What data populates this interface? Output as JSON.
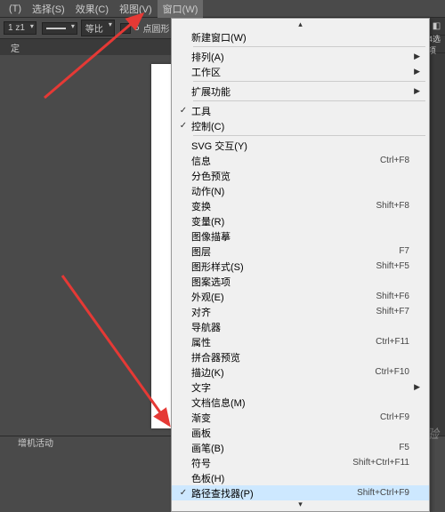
{
  "menubar": {
    "items": [
      {
        "label": "(T)"
      },
      {
        "label": "选择(S)"
      },
      {
        "label": "效果(C)"
      },
      {
        "label": "视图(V)"
      },
      {
        "label": "窗口(W)"
      }
    ]
  },
  "toolbar": {
    "zoom": "1 z1",
    "stroke_label": "等比",
    "shape_count": "5",
    "shape_label": "点圆形"
  },
  "tab": {
    "label": "定"
  },
  "right": {
    "label": "4选项"
  },
  "statusbar": {
    "label": "增机活动"
  },
  "watermark": "Baidu经验",
  "menu": {
    "scroll_up": "▴",
    "groups": [
      {
        "items": [
          {
            "label": "新建窗口(W)",
            "shortcut": "",
            "check": false,
            "submenu": false
          }
        ]
      },
      {
        "items": [
          {
            "label": "排列(A)",
            "shortcut": "",
            "check": false,
            "submenu": true
          },
          {
            "label": "工作区",
            "shortcut": "",
            "check": false,
            "submenu": true
          }
        ]
      },
      {
        "items": [
          {
            "label": "扩展功能",
            "shortcut": "",
            "check": false,
            "submenu": true
          }
        ]
      },
      {
        "items": [
          {
            "label": "工具",
            "shortcut": "",
            "check": true,
            "submenu": false
          },
          {
            "label": "控制(C)",
            "shortcut": "",
            "check": true,
            "submenu": false
          }
        ]
      },
      {
        "items": [
          {
            "label": "SVG 交互(Y)",
            "shortcut": "",
            "check": false,
            "submenu": false
          },
          {
            "label": "信息",
            "shortcut": "Ctrl+F8",
            "check": false,
            "submenu": false
          },
          {
            "label": "分色预览",
            "shortcut": "",
            "check": false,
            "submenu": false
          },
          {
            "label": "动作(N)",
            "shortcut": "",
            "check": false,
            "submenu": false
          },
          {
            "label": "变换",
            "shortcut": "Shift+F8",
            "check": false,
            "submenu": false
          },
          {
            "label": "变量(R)",
            "shortcut": "",
            "check": false,
            "submenu": false
          },
          {
            "label": "图像描摹",
            "shortcut": "",
            "check": false,
            "submenu": false
          },
          {
            "label": "图层",
            "shortcut": "F7",
            "check": false,
            "submenu": false
          },
          {
            "label": "图形样式(S)",
            "shortcut": "Shift+F5",
            "check": false,
            "submenu": false
          },
          {
            "label": "图案选项",
            "shortcut": "",
            "check": false,
            "submenu": false
          },
          {
            "label": "外观(E)",
            "shortcut": "Shift+F6",
            "check": false,
            "submenu": false
          },
          {
            "label": "对齐",
            "shortcut": "Shift+F7",
            "check": false,
            "submenu": false
          },
          {
            "label": "导航器",
            "shortcut": "",
            "check": false,
            "submenu": false
          },
          {
            "label": "属性",
            "shortcut": "Ctrl+F11",
            "check": false,
            "submenu": false
          },
          {
            "label": "拼合器预览",
            "shortcut": "",
            "check": false,
            "submenu": false
          },
          {
            "label": "描边(K)",
            "shortcut": "Ctrl+F10",
            "check": false,
            "submenu": false
          },
          {
            "label": "文字",
            "shortcut": "",
            "check": false,
            "submenu": true
          },
          {
            "label": "文档信息(M)",
            "shortcut": "",
            "check": false,
            "submenu": false
          },
          {
            "label": "渐变",
            "shortcut": "Ctrl+F9",
            "check": false,
            "submenu": false
          },
          {
            "label": "画板",
            "shortcut": "",
            "check": false,
            "submenu": false
          },
          {
            "label": "画笔(B)",
            "shortcut": "F5",
            "check": false,
            "submenu": false
          },
          {
            "label": "符号",
            "shortcut": "Shift+Ctrl+F11",
            "check": false,
            "submenu": false
          },
          {
            "label": "色板(H)",
            "shortcut": "",
            "check": false,
            "submenu": false
          },
          {
            "label": "路径查找器(P)",
            "shortcut": "Shift+Ctrl+F9",
            "check": true,
            "submenu": false,
            "highlight": true
          }
        ]
      }
    ],
    "scroll_down": "▾"
  }
}
